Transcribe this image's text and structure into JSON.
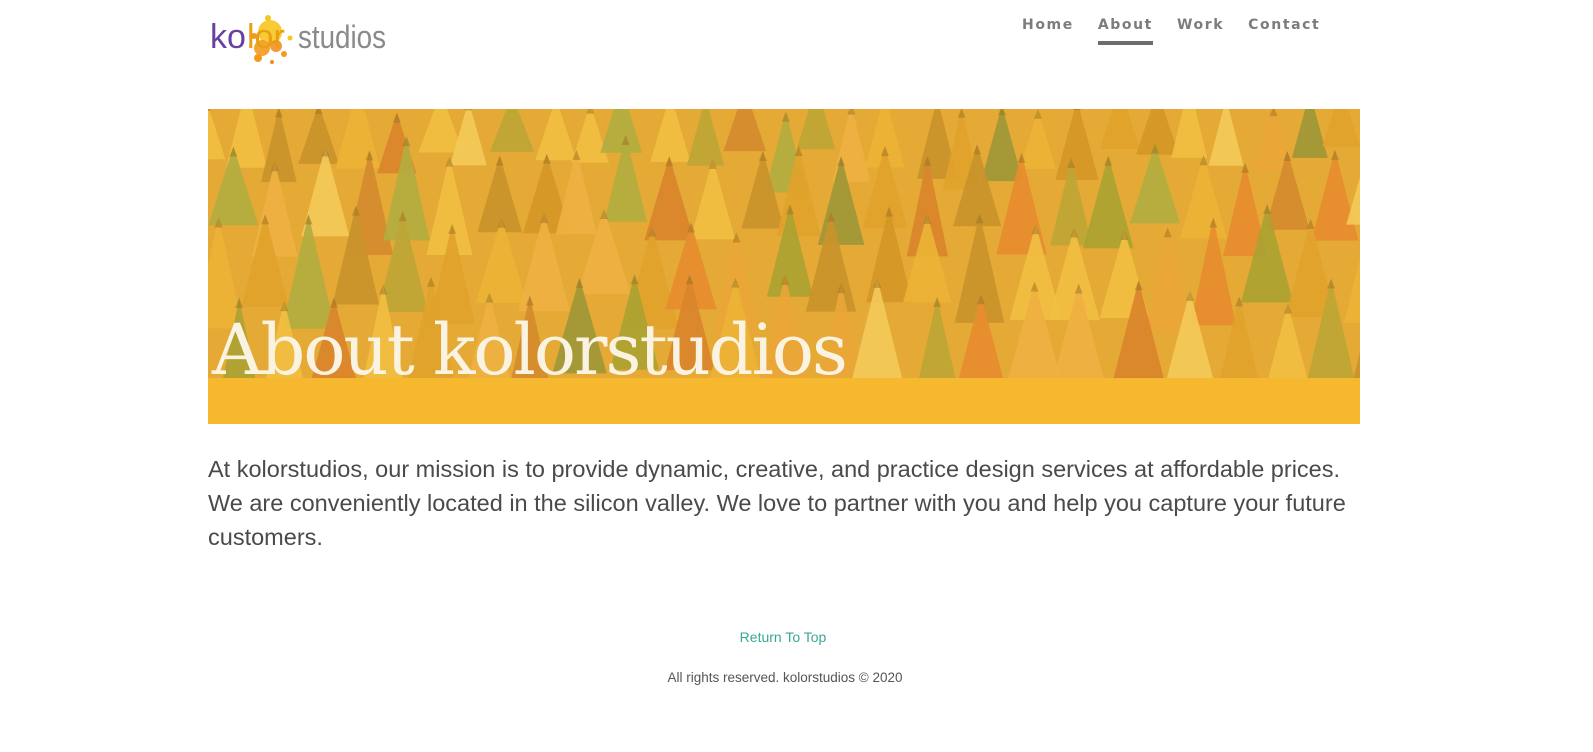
{
  "header": {
    "logo_text": {
      "part1": "ko",
      "part2": "lor",
      "part3": "studios"
    },
    "nav": [
      {
        "label": "Home",
        "active": false
      },
      {
        "label": "About",
        "active": true
      },
      {
        "label": "Work",
        "active": false
      },
      {
        "label": "Contact",
        "active": false
      }
    ]
  },
  "hero": {
    "title": "About kolorstudios",
    "band_color": "#f5b82e"
  },
  "main": {
    "mission": "At kolorstudios, our mission is to provide dynamic, creative, and practice design services at affordable prices. We are conveniently located in the silicon valley. We love to partner with you and help you capture your future customers."
  },
  "footer": {
    "return_top": "Return To Top",
    "copyright": "All rights reserved. kolorstudios © 2020"
  },
  "colors": {
    "link": "#3aa796",
    "nav_text": "#7c7c7c",
    "body_text": "#4a4a4a"
  }
}
